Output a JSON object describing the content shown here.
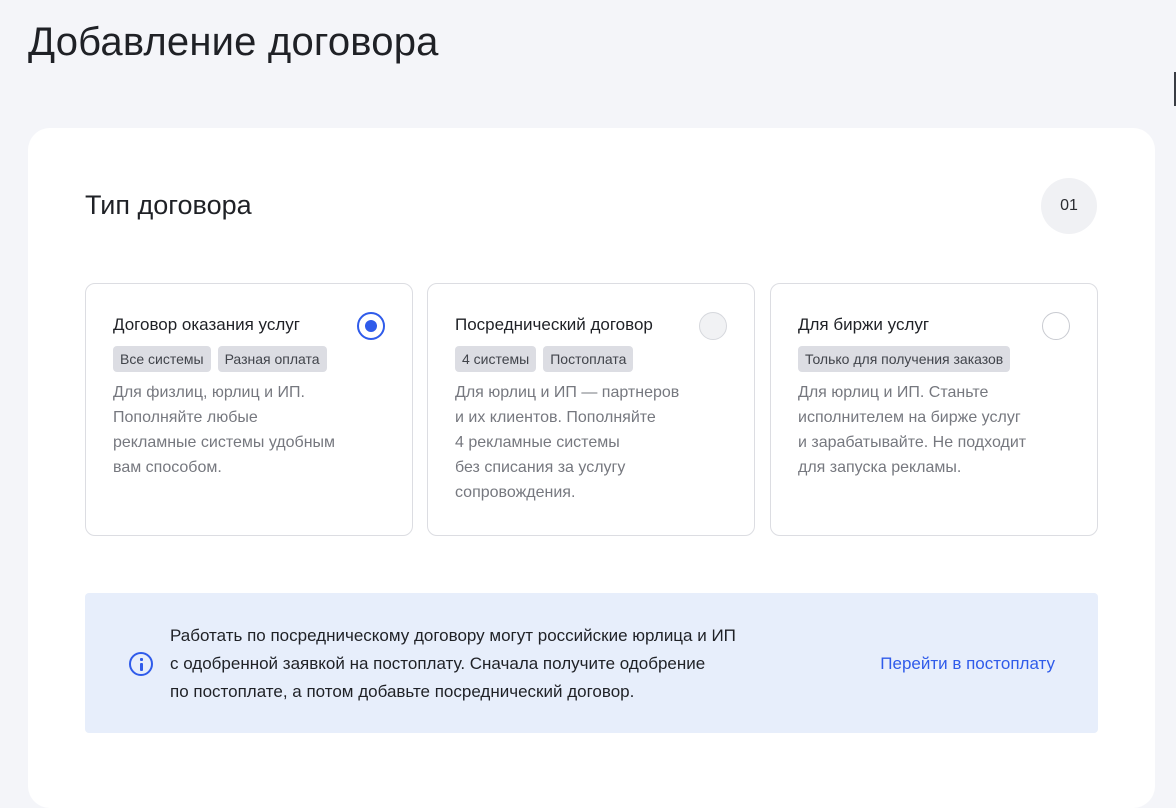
{
  "page": {
    "title": "Добавление договора"
  },
  "section": {
    "title": "Тип договора",
    "step": "01"
  },
  "options": [
    {
      "title": "Договор оказания услуг",
      "state": "selected",
      "tags": [
        "Все системы",
        "Разная оплата"
      ],
      "description": "Для физлиц, юрлиц и ИП.\nПополняйте любые\nрекламные системы удобным\nвам способом."
    },
    {
      "title": "Посреднический договор",
      "state": "disabled",
      "tags": [
        "4 системы",
        "Постоплата"
      ],
      "description": "Для юрлиц и ИП — партнеров\nи их клиентов. Пополняйте\n4 рекламные системы\nбез списания за услугу\nсопровождения."
    },
    {
      "title": "Для биржи услуг",
      "state": "unselected",
      "tags": [
        "Только для получения заказов"
      ],
      "description": "Для юрлиц и ИП. Станьте\nисполнителем на бирже услуг\nи зарабатывайте. Не подходит\nдля запуска рекламы."
    }
  ],
  "info": {
    "icon": "info-icon",
    "text": "Работать по посредническому договору могут российские юрлица и ИП\nс одобренной заявкой на постоплату. Сначала получите одобрение\nпо постоплате, а потом добавьте посреднический договор.",
    "link_label": "Перейти в постоплату"
  },
  "colors": {
    "accent": "#2f5bea",
    "info_bg": "#e7eefb",
    "tag_bg": "#dcdde3"
  }
}
